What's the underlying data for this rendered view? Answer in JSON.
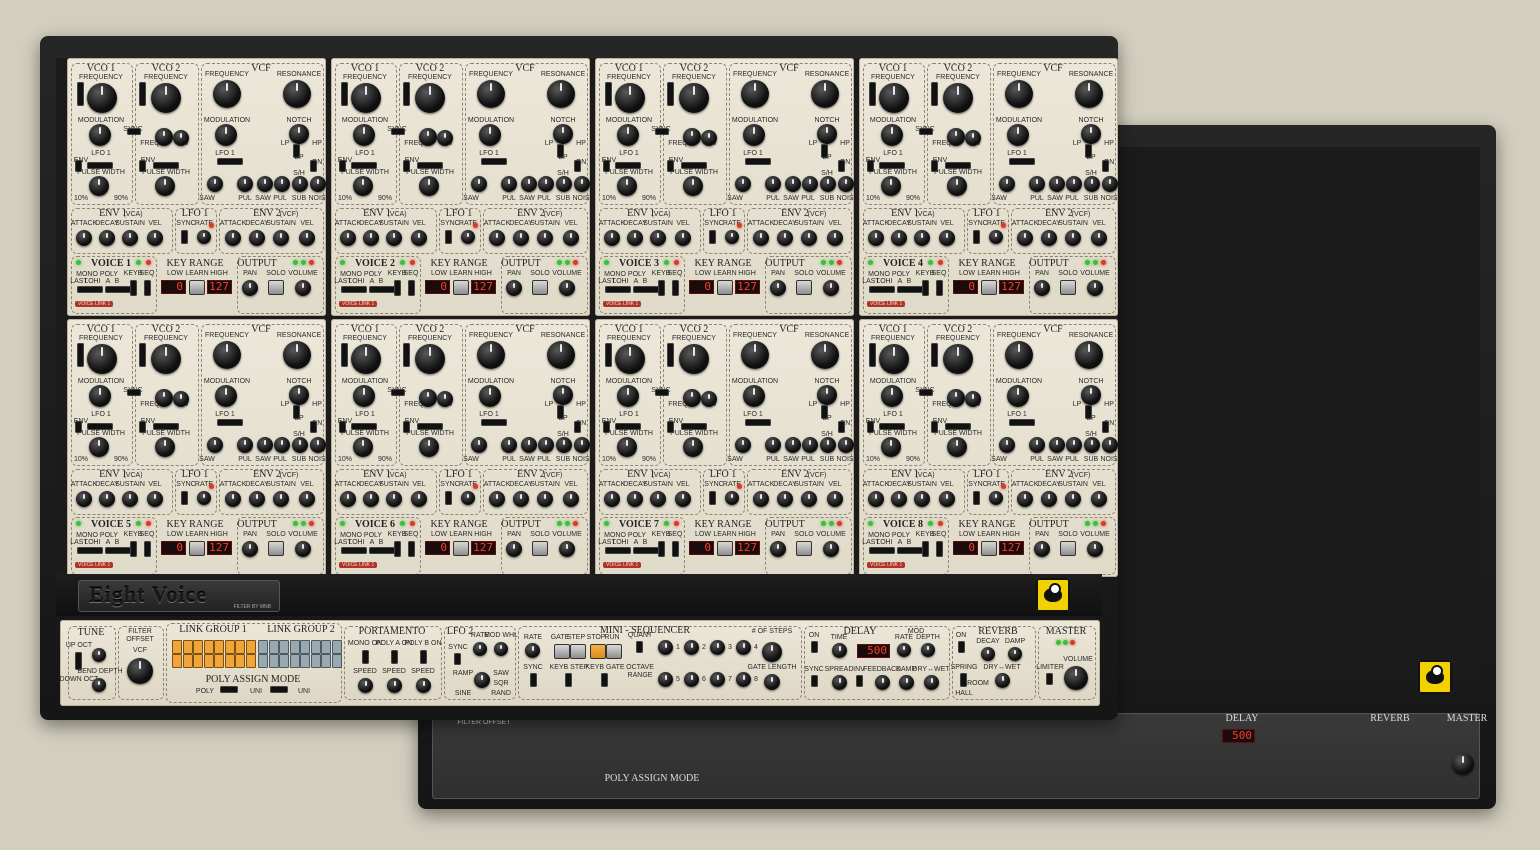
{
  "product": {
    "name": "Eight Voice",
    "subtitle": "FILTER BY MNB"
  },
  "voice_panel": {
    "vco1": "VCO 1",
    "vco2": "VCO 2",
    "vcf": "VCF",
    "frequency": "FREQUENCY",
    "resonance": "RESONANCE",
    "modulation": "MODULATION",
    "notch": "NOTCH",
    "sync": "SYNC",
    "freq": "FREQ",
    "pw": "PW",
    "lp": "LP",
    "hp": "HP",
    "bp": "BP",
    "lfo1_small": "LFO 1",
    "env": "ENV",
    "pulse_width": "PULSE WIDTH",
    "on": "ON",
    "sh": "S/H",
    "saw": "SAW",
    "pul": "PUL",
    "sub": "SUB",
    "nois": "NOIS",
    "pct_10": "10%",
    "pct_90": "90%",
    "env1": "ENV 1",
    "vca": "(VCA)",
    "env2": "ENV 2",
    "vcf_tag": "(VCF)",
    "lfo1": "LFO 1",
    "attack": "ATTACK",
    "decay": "DECAY",
    "sustain": "SUSTAIN",
    "vel": "VEL",
    "rate": "RATE",
    "key_range": "KEY RANGE",
    "low": "LOW",
    "learn": "LEARN",
    "high": "HIGH",
    "low_value": "0",
    "high_value": "127",
    "keyb": "KEYB",
    "seq": "SEQ",
    "mono": "MONO",
    "poly": "POLY",
    "last": "LAST",
    "lo": "LO",
    "hi": "HI",
    "a": "A",
    "b": "B",
    "output": "OUTPUT",
    "pan": "PAN",
    "solo": "SOLO",
    "volume": "VOLUME",
    "voice_link": "VOICE LINK 1"
  },
  "voices": [
    {
      "label": "VOICE 1"
    },
    {
      "label": "VOICE 2"
    },
    {
      "label": "VOICE 3"
    },
    {
      "label": "VOICE 4"
    },
    {
      "label": "VOICE 5"
    },
    {
      "label": "VOICE 6"
    },
    {
      "label": "VOICE 7"
    },
    {
      "label": "VOICE 8"
    }
  ],
  "global": {
    "tune": "TUNE",
    "up_oct": "UP OCT",
    "down_oct": "DOWN OCT",
    "bend_depth": "BEND DEPTH",
    "filter_offset": "FILTER OFFSET",
    "vcf": "VCF",
    "link_group_1": "LINK GROUP 1",
    "link_group_2": "LINK GROUP 2",
    "poly_assign_mode": "POLY ASSIGN MODE",
    "pam_options": [
      "POLY",
      "UNI",
      "UNI"
    ],
    "portamento": "PORTAMENTO",
    "mono_on": "MONO ON",
    "poly_a_on": "POLY A ON",
    "poly_b_on": "POLY B ON",
    "speed": "SPEED",
    "lfo2": "LFO 2",
    "sync": "SYNC",
    "rate": "RATE",
    "mod_whl": "MOD WHL",
    "ramp": "RAMP",
    "saw": "SAW",
    "sine": "SINE",
    "sqr": "SQR",
    "rand": "RAND",
    "tri": "TRI",
    "mini_sequencer": "MINI - SEQUENCER",
    "gate": "GATE",
    "step": "STEP",
    "stop": "STOP",
    "run": "RUN",
    "quant": "QUANT",
    "octave_range": "OCTAVE RANGE",
    "keyb_step": "KEYB STEP",
    "keyb_gate": "KEYB GATE",
    "of_steps": "# OF STEPS",
    "gate_length": "GATE LENGTH",
    "step_numbers": [
      "1",
      "2",
      "3",
      "4",
      "5",
      "6",
      "7",
      "8"
    ],
    "delay": "DELAY",
    "time": "TIME",
    "delay_value": "500",
    "mod": "MOD",
    "depth": "DEPTH",
    "spread": "SPREAD",
    "inv": "INV",
    "feedback": "FEEDBACK",
    "damp": "DAMP",
    "dry_wet": "DRY↔WET",
    "reverb": "REVERB",
    "decay": "DECAY",
    "spring": "SPRING",
    "room": "ROOM",
    "hall": "HALL",
    "master": "MASTER",
    "limiter": "LIMITER",
    "volume": "VOLUME",
    "on": "ON"
  },
  "colors": {
    "background": "#d3cfbf",
    "cream_panel": "#e7e2d3",
    "dark_panel": "#363636",
    "case": "#1d1d1d",
    "logo_yellow": "#f1d200",
    "lcd_red": "#ff3b24",
    "link_orange": "#f0a43a"
  }
}
